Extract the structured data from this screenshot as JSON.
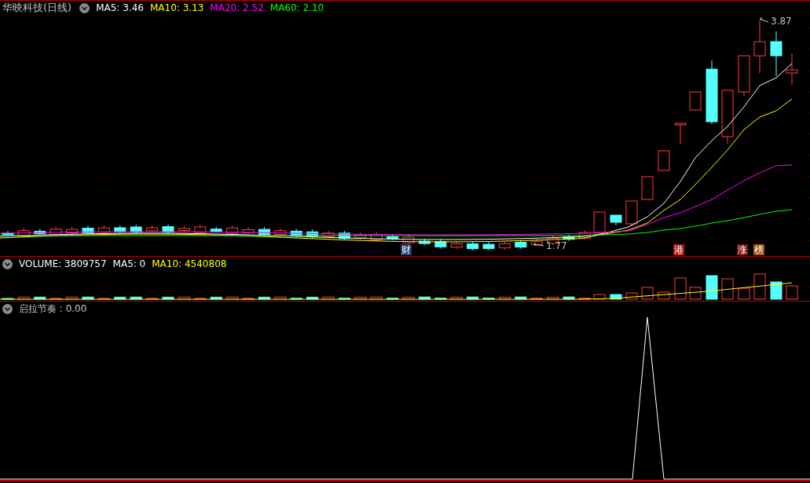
{
  "price_panel": {
    "title": "华映科技(日线)",
    "averages": [
      {
        "label": "MA5: 3.46",
        "color": "#ffffff"
      },
      {
        "label": "MA10: 3.13",
        "color": "#ffff00"
      },
      {
        "label": "MA20: 2.52",
        "color": "#ff00ff"
      },
      {
        "label": "MA60: 2.10",
        "color": "#00ff00"
      }
    ],
    "high_label": "3.87",
    "low_label": "1.77",
    "markers": [
      {
        "text": "财",
        "color": "#1e3c6e"
      },
      {
        "text": "港",
        "color": "#b01818"
      },
      {
        "text": "涨",
        "color": "#801010"
      },
      {
        "text": "榜",
        "color": "#a05010"
      }
    ]
  },
  "volume_panel": {
    "legend": [
      {
        "label": "VOLUME: 3809757",
        "color": "#ffffff"
      },
      {
        "label": "MA5: 0",
        "color": "#ffffff"
      },
      {
        "label": "MA10: 4540808",
        "color": "#ffff00"
      }
    ]
  },
  "indicator_panel": {
    "legend": "启拉节奏 : 0.00"
  }
}
